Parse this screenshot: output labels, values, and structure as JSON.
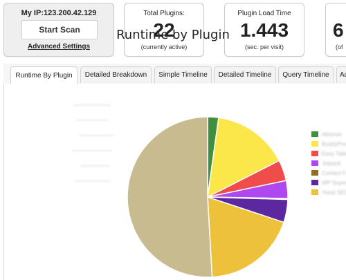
{
  "summary": {
    "ip_label": "My IP:123.200.42.129",
    "scan_button": "Start Scan",
    "advanced_settings": "Advanced Settings"
  },
  "stats": [
    {
      "title": "Total Plugins:",
      "value": "22",
      "subtitle": "(currently active)"
    },
    {
      "title": "Plugin Load Time",
      "value": "1.443",
      "subtitle": "(sec. per visit)"
    },
    {
      "title": "",
      "value": "6",
      "subtitle": "(of"
    }
  ],
  "tabs": [
    "Runtime By Plugin",
    "Detailed Breakdown",
    "Simple Timeline",
    "Detailed Timeline",
    "Query Timeline",
    "Ac"
  ],
  "chart_data": {
    "type": "pie",
    "title": "Runtime by Plugin",
    "values": [
      2.2,
      15.3,
      4.2,
      3.6,
      0.2,
      4.6,
      19.0,
      50.9
    ],
    "colors": [
      "#3f8f3f",
      "#fbe74a",
      "#f04c4c",
      "#b048f0",
      "#8f6f1f",
      "#5b28a0",
      "#edc13b",
      "#c9bb90"
    ],
    "legend_labels": [
      "Akismet",
      "BuddyPress",
      "Easy Table",
      "Jetpack",
      "Contact Form",
      "WP Super Cache",
      "Yoast SEO"
    ]
  }
}
